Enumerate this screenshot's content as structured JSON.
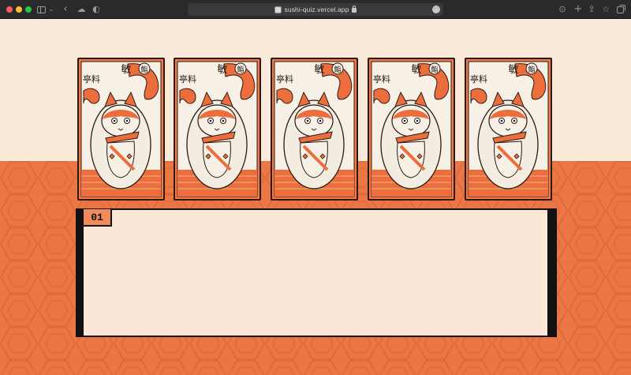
{
  "browser": {
    "url": "sushi-quiz.vercel.app",
    "icons": [
      "sidebar-icon",
      "chevron-down-icon",
      "back-arrow-icon",
      "cloud-icon",
      "shield-icon",
      "favicon-icon",
      "lock-icon",
      "more-icon",
      "download-icon",
      "new-tab-icon",
      "share-icon",
      "star-icon",
      "tabs-overview-icon"
    ]
  },
  "colors": {
    "cream": "#fbe9da",
    "orange": "#ec7746",
    "card_orange": "#f07b45",
    "ink": "#2a1a14"
  },
  "cards": [
    {
      "kanji": "敏",
      "corner": "鮨",
      "side": "亭料"
    },
    {
      "kanji": "敏",
      "corner": "鮨",
      "side": "亭料"
    },
    {
      "kanji": "敏",
      "corner": "鮨",
      "side": "亭料"
    },
    {
      "kanji": "敏",
      "corner": "鮨",
      "side": "亭料"
    },
    {
      "kanji": "敏",
      "corner": "鮨",
      "side": "亭料"
    }
  ],
  "question": {
    "number": "01",
    "text": ""
  }
}
